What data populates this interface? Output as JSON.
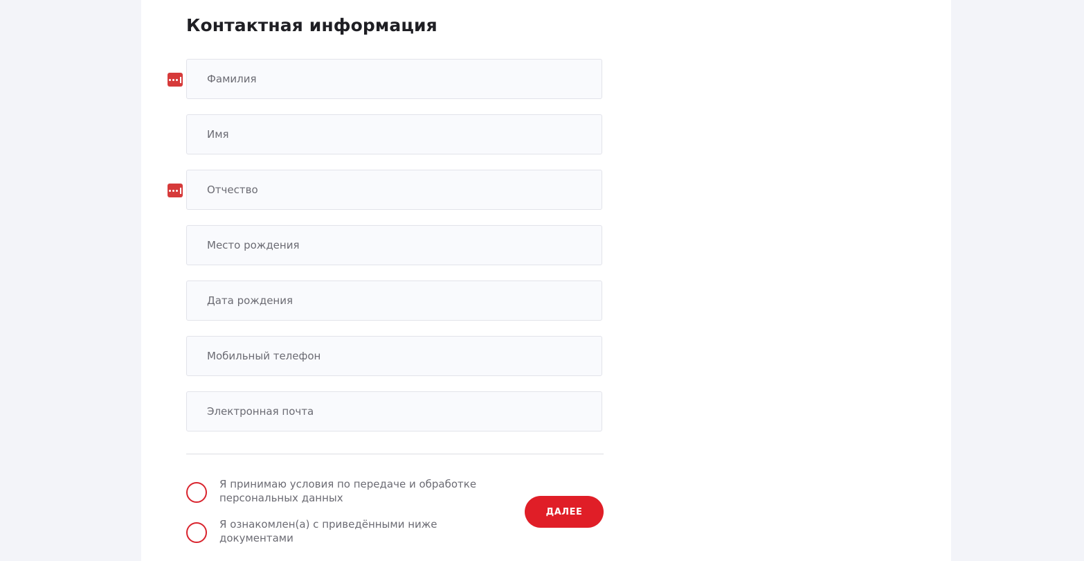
{
  "form": {
    "title": "Контактная информация",
    "fields": [
      {
        "name": "last_name",
        "placeholder": "Фамилия",
        "value": "",
        "autofill_icon": "password-manager-icon"
      },
      {
        "name": "first_name",
        "placeholder": "Имя",
        "value": ""
      },
      {
        "name": "middle_name",
        "placeholder": "Отчество",
        "value": "",
        "autofill_icon": "password-manager-icon"
      },
      {
        "name": "birth_place",
        "placeholder": "Место рождения",
        "value": ""
      },
      {
        "name": "birth_date",
        "placeholder": "Дата рождения",
        "value": ""
      },
      {
        "name": "mobile_phone",
        "placeholder": "Мобильный телефон",
        "value": ""
      },
      {
        "name": "email",
        "placeholder": "Электронная почта",
        "value": ""
      }
    ],
    "consents": [
      {
        "text": "Я принимаю условия по передаче и обработке персональных данных",
        "checked": false
      },
      {
        "text": "Я ознакомлен(а) с приведёнными ниже документами",
        "checked": false
      }
    ],
    "next_label": "ДАЛЕЕ"
  },
  "colors": {
    "accent": "#e01e27",
    "autofill_icon": "#d63a3a",
    "page_background": "#f3f4f9",
    "field_background": "#f9fafd"
  }
}
